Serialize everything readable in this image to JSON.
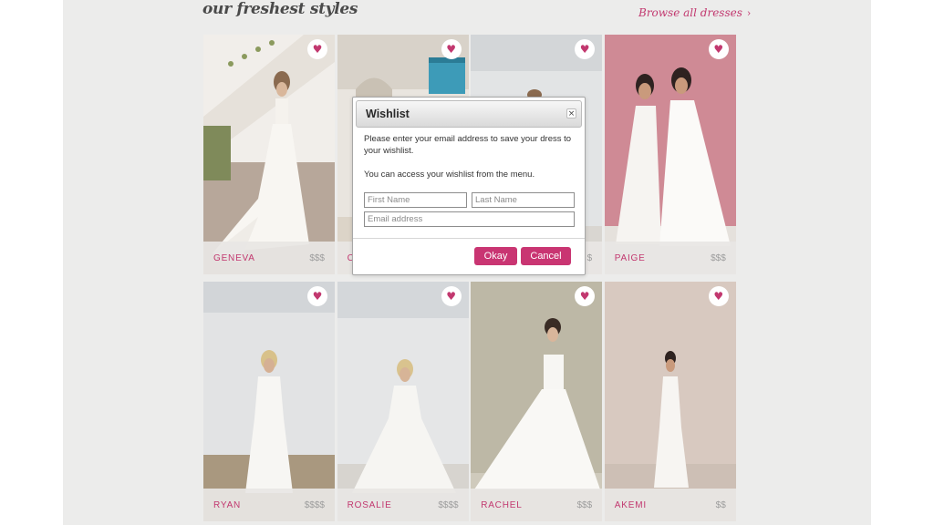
{
  "section": {
    "title": "our freshest styles",
    "browse_link": "Browse all dresses",
    "browse_chevron": "›"
  },
  "wishlist_icon": "♥",
  "products": [
    {
      "name": "GENEVA",
      "price": "$$$"
    },
    {
      "name": "C",
      "price": "$"
    },
    {
      "name": "",
      "price": "$"
    },
    {
      "name": "PAIGE",
      "price": "$$$"
    },
    {
      "name": "RYAN",
      "price": "$$$$"
    },
    {
      "name": "ROSALIE",
      "price": "$$$$"
    },
    {
      "name": "RACHEL",
      "price": "$$$"
    },
    {
      "name": "AKEMI",
      "price": "$$"
    }
  ],
  "modal": {
    "title": "Wishlist",
    "close_icon": "×",
    "message_1": "Please enter your email address to save your dress to your wishlist.",
    "message_2": "You can access your wishlist from the menu.",
    "first_name_placeholder": "First Name",
    "last_name_placeholder": "Last Name",
    "email_placeholder": "Email address",
    "okay_label": "Okay",
    "cancel_label": "Cancel"
  },
  "colors": {
    "accent": "#c93572",
    "page_background": "#ececeb"
  }
}
